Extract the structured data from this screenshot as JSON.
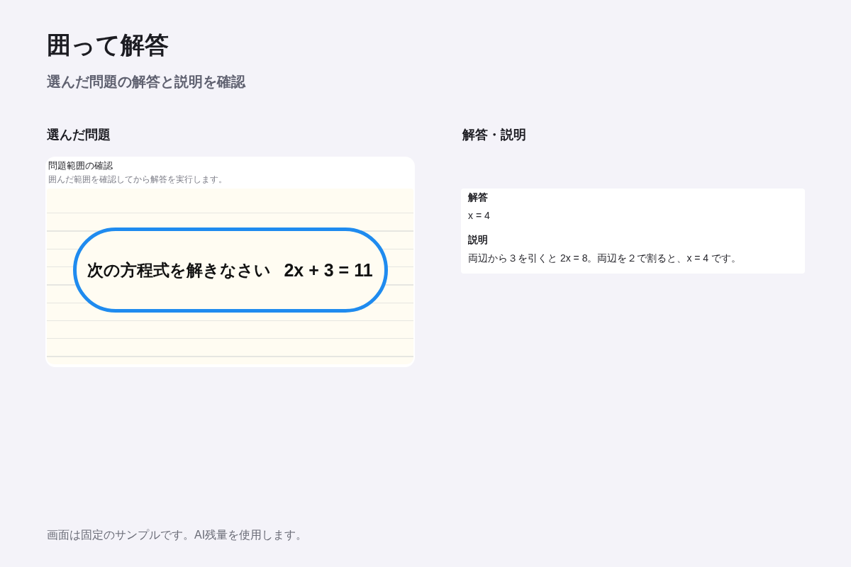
{
  "page": {
    "title": "囲って解答",
    "subtitle": "選んだ問題の解答と説明を確認"
  },
  "selected_problem": {
    "heading": "選んだ問題",
    "card": {
      "title": "問題範囲の確認",
      "hint": "囲んだ範囲を確認してから解答を実行します。",
      "image": {
        "instruction": "次の方程式を解きなさい",
        "equation": "2x + 3 = 11"
      }
    }
  },
  "answer_panel": {
    "heading": "解答・説明",
    "sections": [
      {
        "label": "解答",
        "text": "x = 4"
      },
      {
        "label": "説明",
        "text": "両辺から３を引くと 2x = 8。両辺を２で割ると、x = 4 です。"
      }
    ]
  },
  "footer": "画面は固定のサンプルです。AI残量を使用します。"
}
